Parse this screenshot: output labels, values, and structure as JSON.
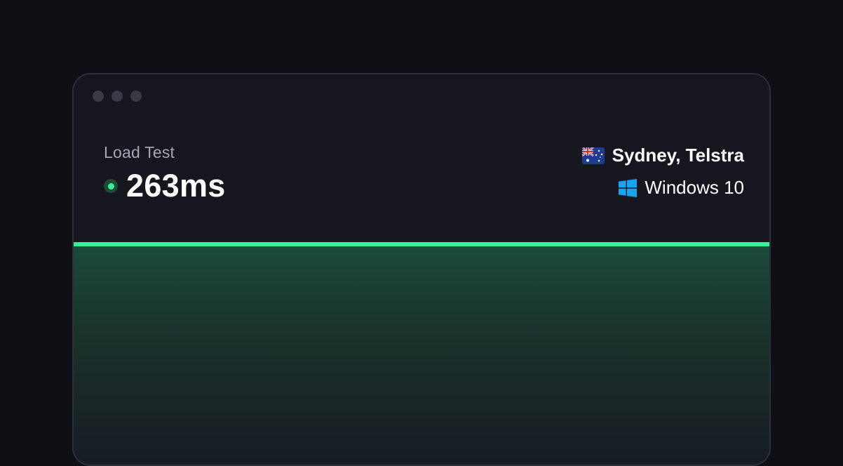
{
  "card": {
    "label": "Load Test",
    "value": "263ms",
    "status_color": "#35f29a",
    "location": "Sydney, Telstra",
    "location_icon": "australia-flag-icon",
    "os": "Windows 10",
    "os_icon": "windows-logo-icon",
    "accent": "#35f29a"
  }
}
